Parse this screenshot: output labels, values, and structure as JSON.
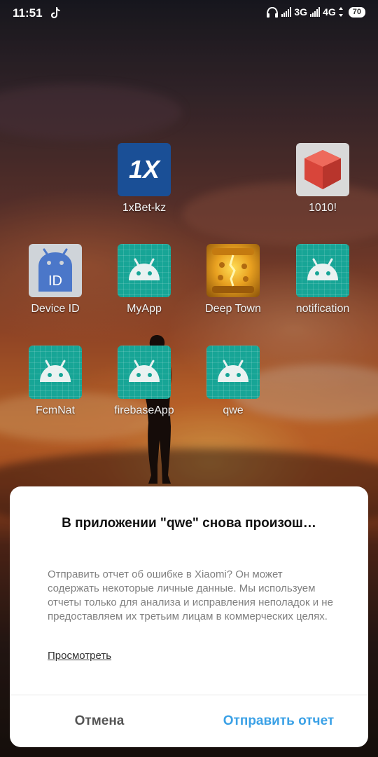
{
  "status_bar": {
    "time": "11:51",
    "net1": "3G",
    "net2": "4G",
    "battery": "70",
    "icons": [
      "tiktok-icon",
      "headphones-icon",
      "signal-icon",
      "signal-icon",
      "battery-icon"
    ]
  },
  "home": {
    "apps": [
      {
        "label": "1xBet-kz",
        "icon": "1xbet-icon",
        "icon_text": "1X"
      },
      {
        "label": "1010!",
        "icon": "red-cube-icon"
      },
      {
        "label": "Device ID",
        "icon": "device-id-icon",
        "icon_text": "ID"
      },
      {
        "label": "MyApp",
        "icon": "android-icon"
      },
      {
        "label": "Deep Town",
        "icon": "deep-town-icon"
      },
      {
        "label": "notification",
        "icon": "android-icon"
      },
      {
        "label": "FcmNat",
        "icon": "android-icon"
      },
      {
        "label": "firebaseApp",
        "icon": "android-icon"
      },
      {
        "label": "qwe",
        "icon": "android-icon"
      }
    ]
  },
  "dialog": {
    "title": "В приложении \"qwe\" снова произош…",
    "message": "Отправить отчет об ошибке в Xiaomi? Он может содержать некоторые личные данные. Мы используем отчеты только для анализа и исправления неполадок и не предоставляем их третьим лицам в коммерческих целях.",
    "view_link": "Просмотреть",
    "cancel_label": "Отмена",
    "send_label": "Отправить отчет"
  },
  "colors": {
    "accent": "#3ba1e6",
    "android_teal": "#17a596",
    "onexbet_blue": "#1a4f96"
  }
}
